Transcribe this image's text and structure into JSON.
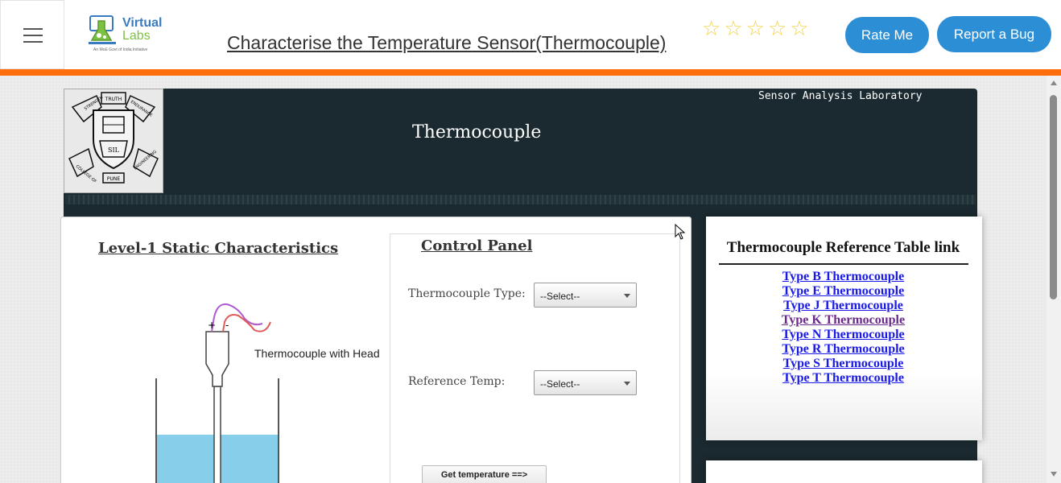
{
  "header": {
    "menu_icon": "hamburger-icon",
    "logo": {
      "line1": "Virtual",
      "line2": "Labs",
      "tagline": "An MoE Govt of India Initiative"
    },
    "title": "Characterise the Temperature Sensor(Thermocouple)",
    "rating_stars": 5,
    "star_icon": "star-outline-icon",
    "rate_button": "Rate Me",
    "bug_button": "Report a Bug",
    "accent_color": "#ff6c0a",
    "button_color": "#2c8fd6"
  },
  "lab": {
    "name": "Sensor Analysis Laboratory",
    "title": "Thermocouple",
    "emblem": {
      "top": "TRUTH",
      "left": "STRENGTH",
      "right": "ENDURANCE",
      "bottom_left": "COLLEGE OF",
      "bottom_right": "ENGINEERING",
      "base": "PUNE"
    }
  },
  "experiment": {
    "level_heading": "Level-1 Static Characteristics",
    "diagram_label": "Thermocouple with Head",
    "polarity_plus": "+",
    "polarity_minus": "-"
  },
  "control_panel": {
    "heading": "Control Panel",
    "type_label": "Thermocouple Type:",
    "type_value": "--Select--",
    "ref_label": "Reference Temp:",
    "ref_value": "--Select--",
    "get_button": "Get temperature ==>"
  },
  "reference": {
    "title": "Thermocouple Reference Table link",
    "links": [
      "Type B Thermocouple",
      "Type E Thermocouple",
      "Type J Thermocouple",
      "Type K Thermocouple",
      "Type N Thermocouple",
      "Type R Thermocouple",
      "Type S Thermocouple",
      "Type T Thermocouple"
    ]
  }
}
